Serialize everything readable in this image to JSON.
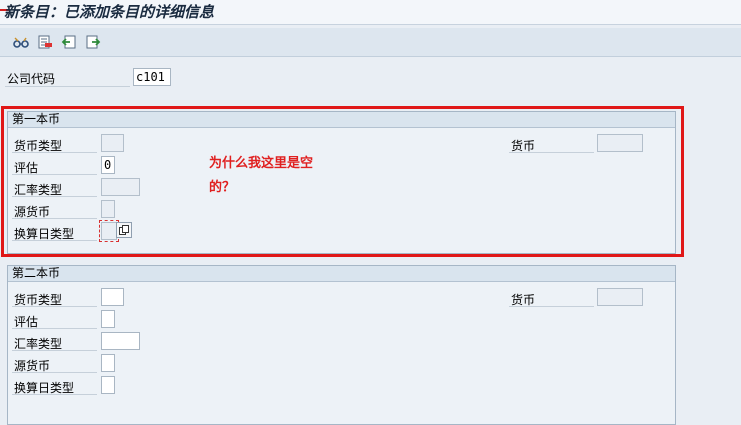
{
  "window": {
    "title": "新条目：已添加条目的详细信息"
  },
  "toolbar": {
    "icons": [
      "glasses-icon",
      "delete-row-icon",
      "previous-entry-icon",
      "next-entry-icon"
    ]
  },
  "company": {
    "label": "公司代码",
    "value": "c101"
  },
  "group1": {
    "title": "第一本币",
    "currency_type_label": "货币类型",
    "currency_label": "货币",
    "valuation_label": "评估",
    "valuation_value": "0",
    "exchange_rate_type_label": "汇率类型",
    "source_currency_label": "源货币",
    "translation_date_type_label": "换算日类型"
  },
  "annotation": {
    "line1": "为什么我这里是空",
    "line2": "的？"
  },
  "group2": {
    "title": "第二本币",
    "currency_type_label": "货币类型",
    "currency_label": "货币",
    "valuation_label": "评估",
    "exchange_rate_type_label": "汇率类型",
    "source_currency_label": "源货币",
    "translation_date_type_label": "换算日类型"
  },
  "colors": {
    "annotation_red": "#e02020",
    "highlight_border": "#e01717",
    "panel_bg": "#edf2f7"
  }
}
